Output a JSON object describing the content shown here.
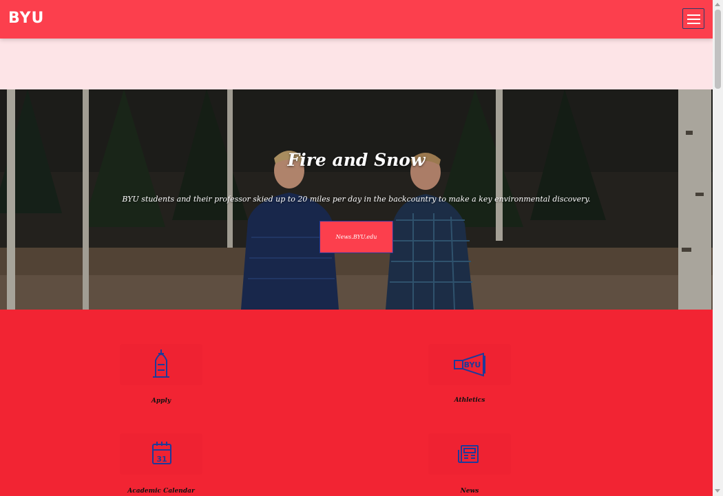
{
  "header": {
    "logo": "BYU",
    "menu_icon": "hamburger-menu-icon"
  },
  "hero": {
    "title": "Fire and Snow",
    "subtitle": "BYU students and their professor skied up to 20 miles per day in the backcountry to make a key environmental discovery.",
    "button_label": "News.BYU.edu"
  },
  "quick_links": [
    {
      "label": "Apply",
      "icon": "apply-icon"
    },
    {
      "label": "Athletics",
      "icon": "athletics-megaphone-icon"
    },
    {
      "label": "Academic Calendar",
      "icon": "calendar-icon",
      "icon_text": "31"
    },
    {
      "label": "News",
      "icon": "newspaper-icon"
    }
  ],
  "colors": {
    "header_bg": "#fc3f4d",
    "pink_band": "#fde4e7",
    "links_bg": "#f22433",
    "icon_blue": "#1e3a9a",
    "button_border": "#2a3a9a"
  }
}
